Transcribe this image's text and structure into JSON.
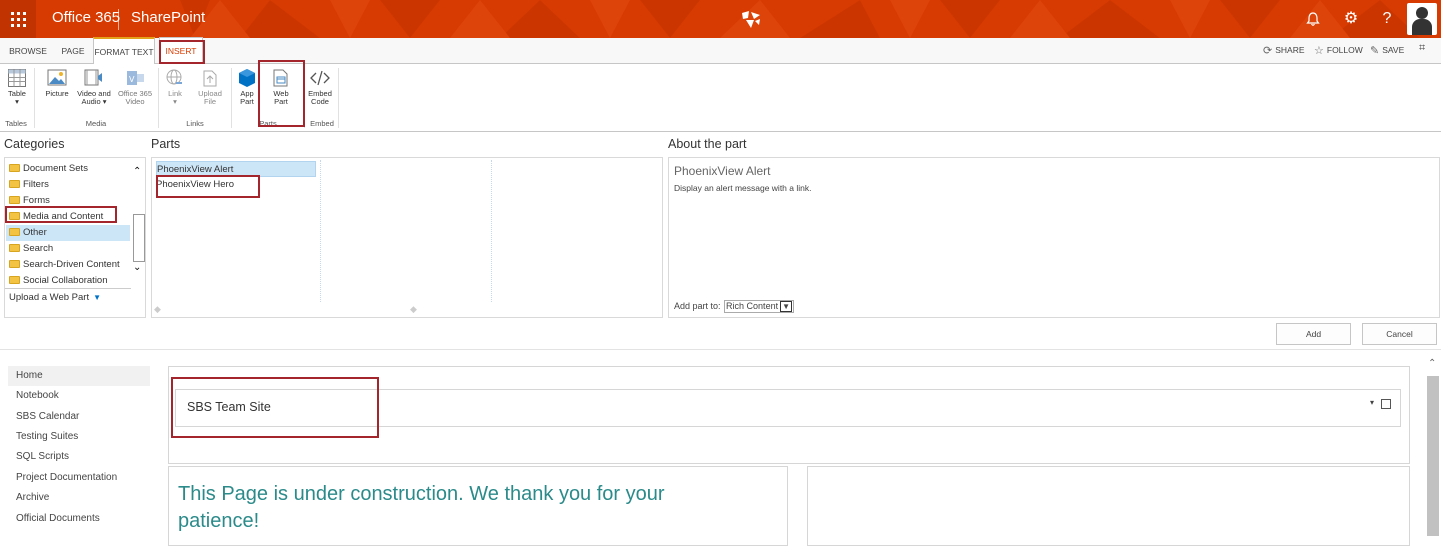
{
  "suite_bar": {
    "app_launcher_icon": "waffle-icon",
    "office_label": "Office 365",
    "sharepoint_label": "SharePoint",
    "icons": [
      "bell-icon",
      "gear-icon",
      "help-icon"
    ],
    "brand_color": "#d83b01"
  },
  "ribbon": {
    "tabs": [
      "BROWSE",
      "PAGE",
      "FORMAT TEXT",
      "INSERT"
    ],
    "actions": {
      "share": "SHARE",
      "follow": "FOLLOW",
      "save": "SAVE"
    },
    "buttons": {
      "table": [
        "Table",
        "▾"
      ],
      "picture": [
        "Picture"
      ],
      "video_audio": [
        "Video and",
        "Audio ▾"
      ],
      "o365_video": [
        "Office 365",
        "Video"
      ],
      "link": [
        "Link",
        "▾"
      ],
      "upload_file": [
        "Upload",
        "File"
      ],
      "app_part": [
        "App",
        "Part"
      ],
      "web_part": [
        "Web",
        "Part"
      ],
      "embed_code": [
        "Embed",
        "Code"
      ]
    },
    "groups": {
      "tables": "Tables",
      "media": "Media",
      "links": "Links",
      "parts": "Parts",
      "embed": "Embed"
    }
  },
  "adder": {
    "categories_title": "Categories",
    "parts_title": "Parts",
    "about_title": "About the part",
    "categories": [
      "Document Sets",
      "Filters",
      "Forms",
      "Media and Content",
      "Other",
      "Search",
      "Search-Driven Content",
      "Social Collaboration"
    ],
    "selected_category": "Other",
    "upload_label": "Upload a Web Part",
    "parts": [
      "PhoenixView Alert",
      "PhoenixView Hero"
    ],
    "selected_part": "PhoenixView Alert",
    "about_name": "PhoenixView Alert",
    "about_desc": "Display an alert message with a link.",
    "add_part_to_label": "Add part to:",
    "add_part_to_value": "Rich Content",
    "add_label": "Add",
    "cancel_label": "Cancel"
  },
  "nav": [
    "Home",
    "Notebook",
    "SBS Calendar",
    "Testing Suites",
    "SQL Scripts",
    "Project Documentation",
    "Archive",
    "Official Documents"
  ],
  "page": {
    "site_title": "SBS Team Site",
    "construction_text": "This Page is under construction. We thank you for your patience!"
  }
}
